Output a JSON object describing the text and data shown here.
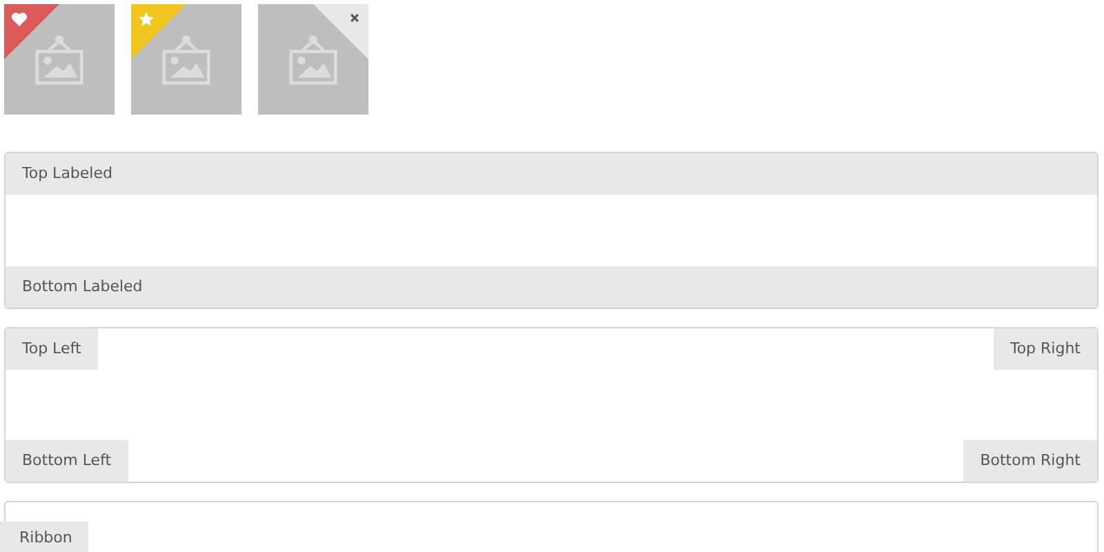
{
  "images": [
    {
      "kind": "heart",
      "color": "#db5b5b"
    },
    {
      "kind": "star",
      "color": "#f2c61f"
    },
    {
      "kind": "close",
      "color": "#e8e8e8"
    }
  ],
  "attached_segment": {
    "top_label": "Top Labeled",
    "bottom_label": "Bottom Labeled"
  },
  "corner_segment": {
    "labels": [
      {
        "kind": "top-left",
        "text": "Top Left"
      },
      {
        "kind": "top-right",
        "text": "Top Right"
      },
      {
        "kind": "bottom-left",
        "text": "Bottom Left"
      },
      {
        "kind": "bottom-right",
        "text": "Bottom Right"
      }
    ]
  },
  "ribbon_segment": {
    "ribbon": "Ribbon"
  }
}
